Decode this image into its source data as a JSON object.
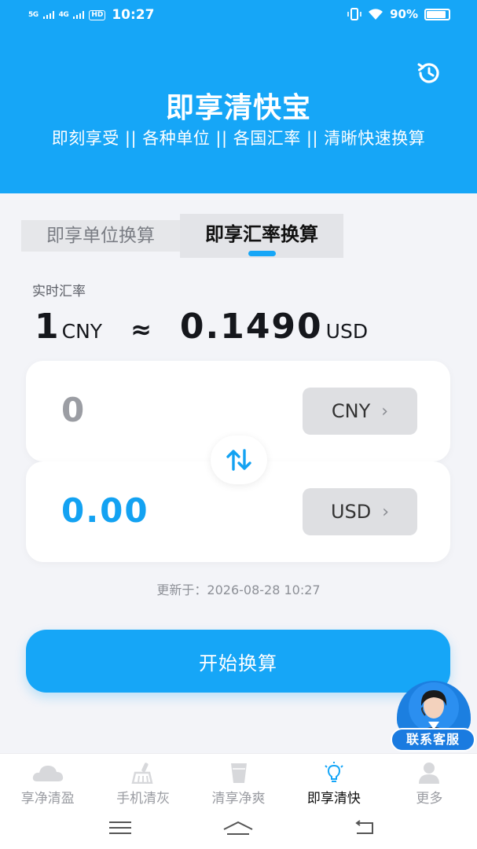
{
  "status_bar": {
    "signal_1": "5G",
    "signal_2": "4G",
    "hd": "HD",
    "time": "10:27",
    "battery_percent": "90%",
    "battery_level": 0.9
  },
  "header": {
    "title": "即享清快宝",
    "subtitle": "即刻享受 || 各种单位 || 各国汇率 || 清晰快速换算",
    "history_icon": "history-icon"
  },
  "tabs": {
    "unit": "即享单位换算",
    "rate": "即享汇率换算",
    "active": "rate"
  },
  "realtime": {
    "label": "实时汇率",
    "from_amount": "1",
    "from_currency": "CNY",
    "approx": "≈",
    "to_amount": "0.1490",
    "to_currency": "USD"
  },
  "converter": {
    "from_value": "0",
    "from_currency_btn": "CNY",
    "to_value": "0.00",
    "to_currency_btn": "USD",
    "chevron": "›",
    "swap_icon": "swap-vertical-icon"
  },
  "updated_text": "更新于：2026-08-28 10:27",
  "start_button": "开始换算",
  "support_label": "联系客服",
  "bottom_nav": [
    {
      "label": "享净清盈",
      "icon": "cloud-icon"
    },
    {
      "label": "手机清灰",
      "icon": "broom-icon"
    },
    {
      "label": "清享净爽",
      "icon": "cup-icon"
    },
    {
      "label": "即享清快",
      "icon": "lightbulb-icon"
    },
    {
      "label": "更多",
      "icon": "person-icon"
    }
  ],
  "colors": {
    "accent": "#16a6f7",
    "active_text": "#111111",
    "inactive_text": "#9a9ca2"
  }
}
